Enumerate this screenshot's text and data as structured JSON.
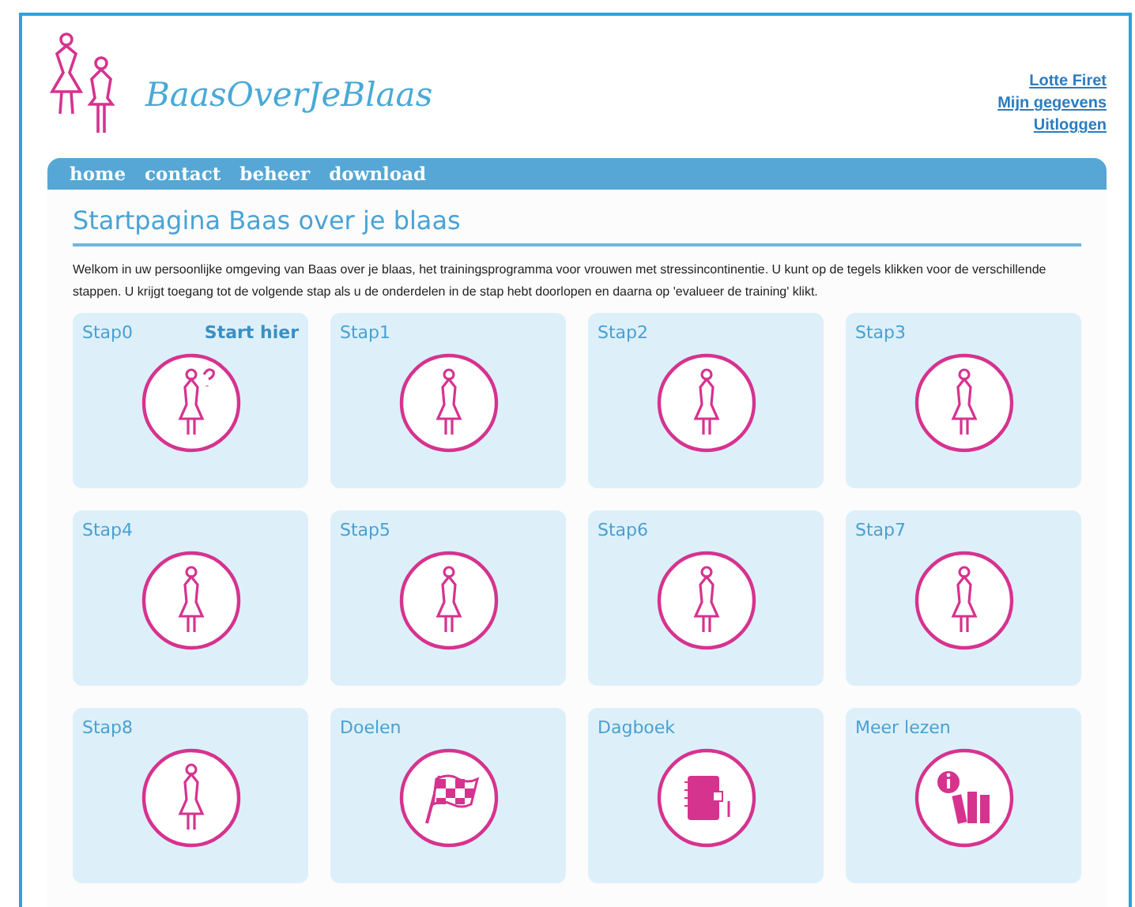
{
  "header": {
    "logo_text": "BaasOverJeBlaas",
    "user_links": [
      "Lotte Firet",
      "Mijn gegevens",
      "Uitloggen"
    ]
  },
  "nav": [
    "home",
    "contact",
    "beheer",
    "download"
  ],
  "page": {
    "title": "Startpagina Baas over je blaas",
    "intro": "Welkom in uw persoonlijke omgeving van Baas over je blaas, het trainingsprogramma voor vrouwen met stressincontinentie. U kunt op de tegels klikken voor de verschillende stappen. U krijgt toegang tot de volgende stap als u de onderdelen in de stap hebt doorlopen en daarna op 'evalueer de training' klikt."
  },
  "tiles": [
    {
      "label": "Stap0",
      "kind": "figure",
      "note": "Start hier",
      "question": true
    },
    {
      "label": "Stap1",
      "kind": "figure"
    },
    {
      "label": "Stap2",
      "kind": "figure"
    },
    {
      "label": "Stap3",
      "kind": "figure"
    },
    {
      "label": "Stap4",
      "kind": "figure"
    },
    {
      "label": "Stap5",
      "kind": "figure"
    },
    {
      "label": "Stap6",
      "kind": "figure"
    },
    {
      "label": "Stap7",
      "kind": "figure"
    },
    {
      "label": "Stap8",
      "kind": "figure"
    },
    {
      "label": "Doelen",
      "kind": "flag"
    },
    {
      "label": "Dagboek",
      "kind": "diary"
    },
    {
      "label": "Meer lezen",
      "kind": "books"
    }
  ]
}
